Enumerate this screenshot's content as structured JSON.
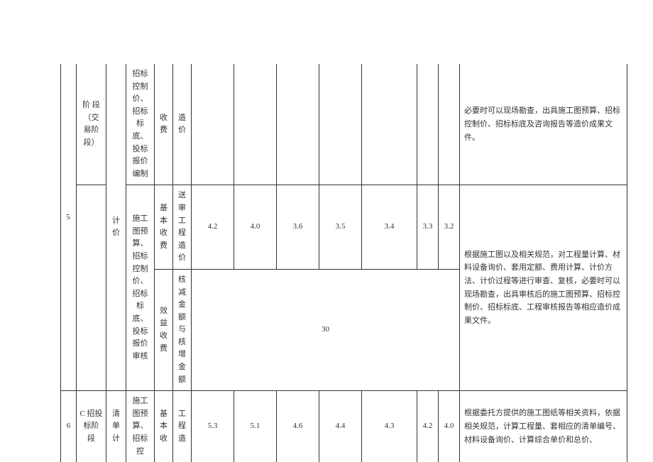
{
  "rows": {
    "r0": {
      "col_b": "阶 段（交 易阶 段）",
      "col_c": "计价",
      "col_d": "招标控制价、招标标底、投标报价编制",
      "col_e": "收费",
      "col_f": "造价",
      "desc": "必要时可以现场勘查，出具施工图预算、招标控制价、招标标底及咨询报告等造价成果文件。"
    },
    "r5a": {
      "idx": "5",
      "col_d": "施工图预算、招标控制价、招标标底、投标报价审核",
      "col_e": "基本收费",
      "col_f": "送审工程造价",
      "v1": "4.2",
      "v2": "4.0",
      "v3": "3.6",
      "v4": "3.5",
      "v5": "3.4",
      "v6": "3.3",
      "v7": "3.2",
      "desc": "根据施工图以及相关规范，对工程量计算、材料设备询价、套用定额、费用计算、计价方法、计价过程等进行审查、复核，必要时可以现场勘查，出具审核后的施工图预算、招标控制价、招标标底、工程审核报告等相应造价成果文件。"
    },
    "r5b": {
      "col_e": "效益收费",
      "col_f": "核减金额与核增金额",
      "val": "30"
    },
    "r6": {
      "idx": "6",
      "col_b": "C 招投 标阶 段",
      "col_c": "清单计",
      "col_d": "施工图预算、招标控",
      "col_e": "基本收",
      "col_f": "工程造",
      "v1": "5.3",
      "v2": "5.1",
      "v3": "4.6",
      "v4": "4.4",
      "v5": "4.3",
      "v6": "4.2",
      "v7": "4.0",
      "desc": "根据委托方提供的施工图纸等相关资料，依据相关规范，计算工程量、套相应的清单编号、材料设备询价、计算综合单价和总价、"
    }
  }
}
